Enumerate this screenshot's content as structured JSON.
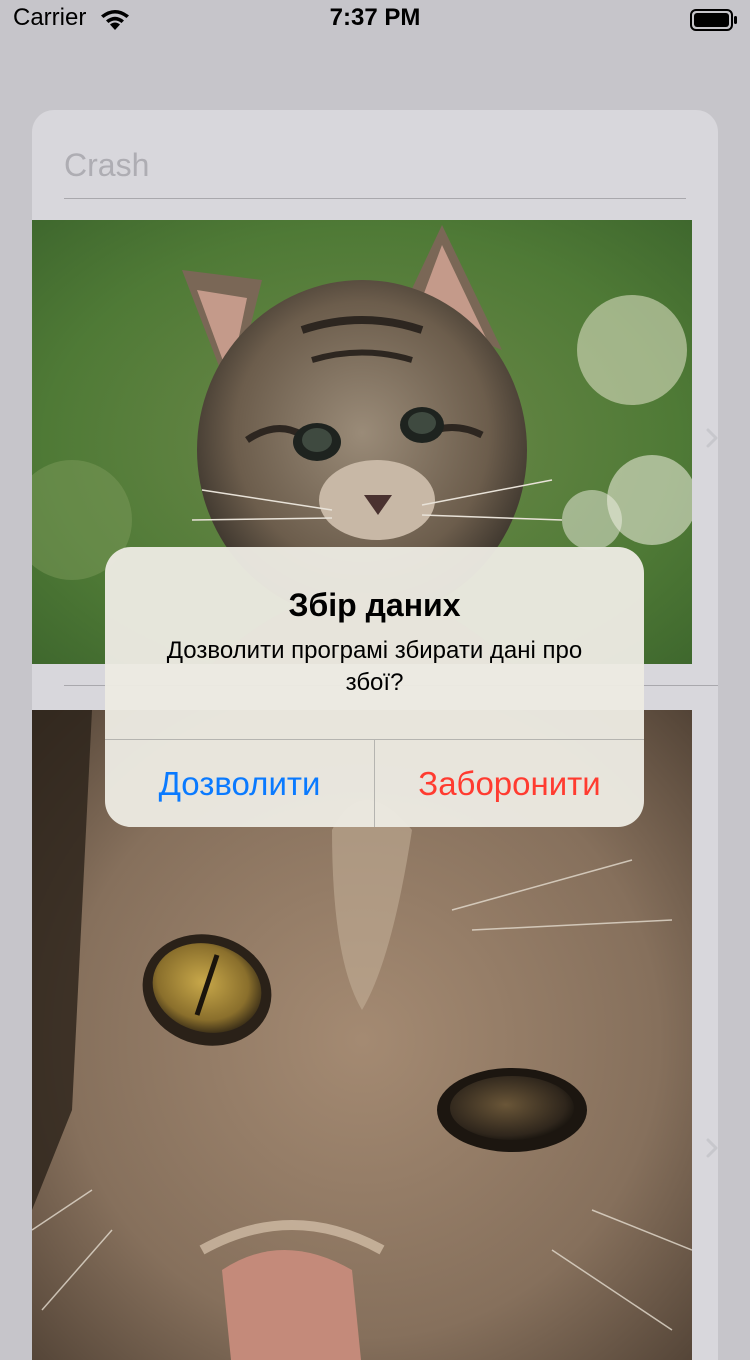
{
  "status_bar": {
    "carrier": "Carrier",
    "time": "7:37 PM",
    "icons": [
      "wifi-icon",
      "battery-icon"
    ]
  },
  "search": {
    "placeholder": "Crash",
    "value": ""
  },
  "rows": [
    {
      "image": "kitten-photo",
      "icon": "chevron-right-icon"
    },
    {
      "image": "cat-face-photo",
      "icon": "chevron-right-icon"
    }
  ],
  "alert": {
    "title": "Збір даних",
    "message": "Дозволити програмі збирати дані про збої?",
    "buttons": {
      "allow": "Дозволити",
      "deny": "Заборонити"
    },
    "colors": {
      "allow": "#0a7aff",
      "deny": "#ff3b30"
    }
  }
}
